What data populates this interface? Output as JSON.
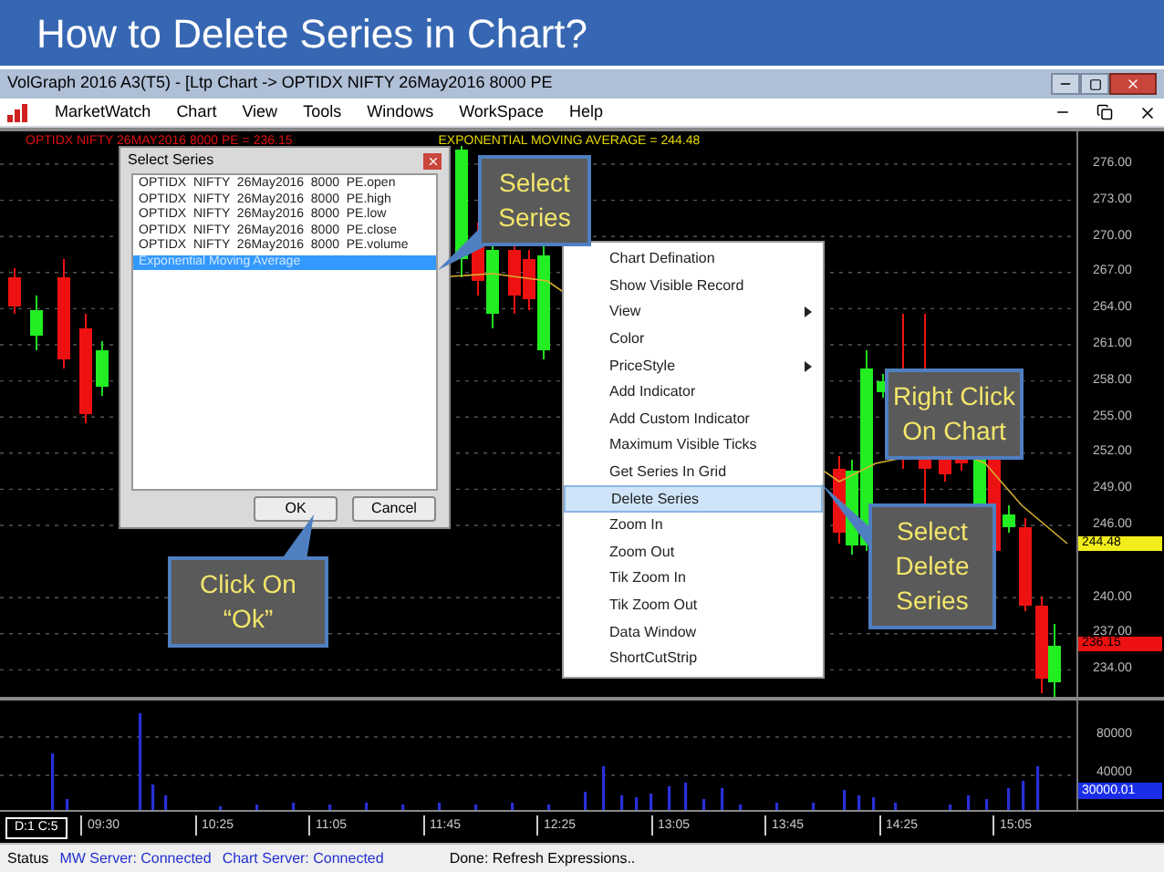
{
  "slide_title": "How to Delete Series in Chart?",
  "window": {
    "title": "VolGraph 2016 A3(T5) - [Ltp Chart -> OPTIDX  NIFTY  26May2016  8000  PE"
  },
  "menu": [
    "MarketWatch",
    "Chart",
    "View",
    "Tools",
    "Windows",
    "WorkSpace",
    "Help"
  ],
  "chart": {
    "headers": [
      {
        "text": "OPTIDX  NIFTY  26MAY2016  8000  PE = 236.15",
        "color": "#e01010"
      },
      {
        "text": "EXPONENTIAL MOVING AVERAGE = 244.48",
        "color": "#e8d800"
      }
    ],
    "price_ticks": [
      "276.00",
      "273.00",
      "270.00",
      "267.00",
      "264.00",
      "261.00",
      "258.00",
      "255.00",
      "252.00",
      "249.00",
      "246.00",
      "240.00",
      "237.00",
      "234.00"
    ],
    "badges": [
      {
        "text": "244.48",
        "color": "#f2ee1c"
      },
      {
        "text": "236.15",
        "color": "#ee1111"
      }
    ],
    "volume_ticks": [
      "80000",
      "40000"
    ],
    "volume_badge": "30000.01",
    "counter": "D:1 C:5",
    "time_ticks": [
      "09:30",
      "10:25",
      "11:05",
      "11:45",
      "12:25",
      "13:05",
      "13:45",
      "14:25",
      "15:05"
    ]
  },
  "dialog": {
    "title": "Select Series",
    "items": [
      {
        "label": "OPTIDX  NIFTY  26May2016  8000  PE.open",
        "selected": false
      },
      {
        "label": "OPTIDX  NIFTY  26May2016  8000  PE.high",
        "selected": false
      },
      {
        "label": "OPTIDX  NIFTY  26May2016  8000  PE.low",
        "selected": false
      },
      {
        "label": "OPTIDX  NIFTY  26May2016  8000  PE.close",
        "selected": false
      },
      {
        "label": "OPTIDX  NIFTY  26May2016  8000  PE.volume",
        "selected": false
      },
      {
        "label": "Exponential Moving Average",
        "selected": true
      }
    ],
    "buttons": [
      "OK",
      "Cancel"
    ]
  },
  "context_menu": [
    {
      "label": "Chart Defination",
      "selected": false,
      "submenu": false
    },
    {
      "label": "Show Visible Record",
      "selected": false,
      "submenu": false
    },
    {
      "label": "View",
      "selected": false,
      "submenu": true
    },
    {
      "label": "Color",
      "selected": false,
      "submenu": false
    },
    {
      "label": "PriceStyle",
      "selected": false,
      "submenu": true
    },
    {
      "label": "Add Indicator",
      "selected": false,
      "submenu": false
    },
    {
      "label": "Add Custom Indicator",
      "selected": false,
      "submenu": false
    },
    {
      "label": "Maximum Visible Ticks",
      "selected": false,
      "submenu": false
    },
    {
      "label": "Get Series In Grid",
      "selected": false,
      "submenu": false
    },
    {
      "label": "Delete Series",
      "selected": true,
      "submenu": false
    },
    {
      "label": "Zoom In",
      "selected": false,
      "submenu": false
    },
    {
      "label": "Zoom Out",
      "selected": false,
      "submenu": false
    },
    {
      "label": "Tik Zoom In",
      "selected": false,
      "submenu": false
    },
    {
      "label": "Tik Zoom Out",
      "selected": false,
      "submenu": false
    },
    {
      "label": "Data Window",
      "selected": false,
      "submenu": false
    },
    {
      "label": "ShortCutStrip",
      "selected": false,
      "submenu": false
    }
  ],
  "callouts": [
    {
      "lines": [
        "Select",
        "Series"
      ]
    },
    {
      "lines": [
        "Right Click",
        "On Chart"
      ]
    },
    {
      "lines": [
        "Select",
        "Delete",
        "Series"
      ]
    },
    {
      "lines": [
        "Click On",
        "“Ok”"
      ]
    }
  ],
  "status_bar": {
    "label": "Status",
    "connections": [
      "MW Server: Connected",
      "Chart Server: Connected"
    ],
    "message": "Done: Refresh Expressions.."
  }
}
